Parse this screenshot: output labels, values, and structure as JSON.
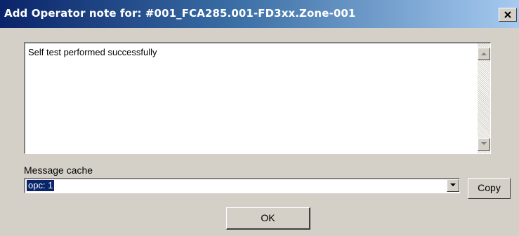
{
  "window": {
    "title": "Add Operator note for: #001_FCA285.001-FD3xx.Zone-001",
    "close_icon": "close-icon"
  },
  "note": {
    "text": "Self test performed successfully"
  },
  "cache": {
    "label": "Message cache",
    "value": "opc: 1"
  },
  "buttons": {
    "copy": "Copy",
    "ok": "OK"
  },
  "colors": {
    "titlebar_start": "#0a246a",
    "titlebar_end": "#a6caf0",
    "face": "#d4d0c8",
    "selection": "#0a246a"
  }
}
